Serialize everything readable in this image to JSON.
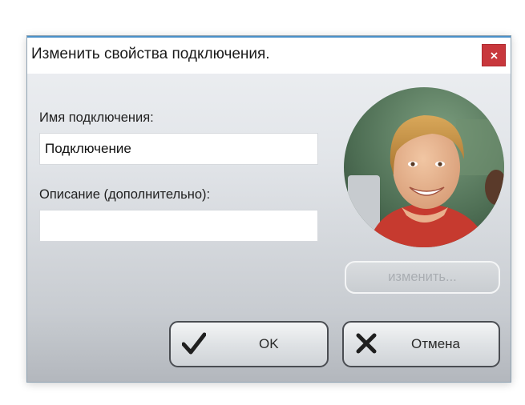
{
  "dialog": {
    "title": "Изменить свойства подключения.",
    "close_symbol": "x"
  },
  "form": {
    "name_label": "Имя подключения:",
    "name_value": "Подключение",
    "description_label": "Описание (дополнительно):",
    "description_value": ""
  },
  "avatar": {
    "alt": "фото пользователя",
    "change_label": "изменить..."
  },
  "buttons": {
    "ok_label": "OK",
    "ok_icon": "checkmark-icon",
    "cancel_label": "Отмена",
    "cancel_icon": "cross-icon"
  },
  "colors": {
    "close_button": "#c8373c",
    "titlebar_accent": "#4a90c8"
  }
}
